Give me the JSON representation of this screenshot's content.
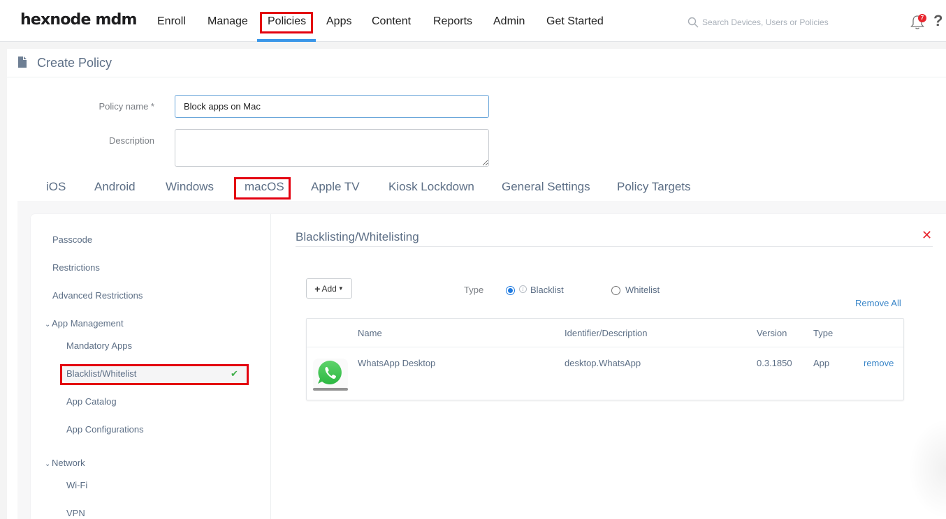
{
  "brand": {
    "logo": "hexnode mdm"
  },
  "topnav": {
    "items": [
      {
        "label": "Enroll"
      },
      {
        "label": "Manage"
      },
      {
        "label": "Policies",
        "active": true
      },
      {
        "label": "Apps"
      },
      {
        "label": "Content"
      },
      {
        "label": "Reports"
      },
      {
        "label": "Admin"
      },
      {
        "label": "Get Started"
      }
    ],
    "search_placeholder": "Search Devices, Users or Policies",
    "notification_count": "7",
    "help_label": "?"
  },
  "page": {
    "title": "Create Policy",
    "form": {
      "policy_name_label": "Policy name *",
      "policy_name_value": "Block apps on Mac",
      "description_label": "Description",
      "description_value": ""
    },
    "os_tabs": [
      {
        "label": "iOS"
      },
      {
        "label": "Android"
      },
      {
        "label": "Windows"
      },
      {
        "label": "macOS",
        "active": true
      },
      {
        "label": "Apple TV"
      },
      {
        "label": "Kiosk Lockdown"
      },
      {
        "label": "General Settings"
      },
      {
        "label": "Policy Targets"
      }
    ]
  },
  "sidebar": {
    "items": [
      {
        "label": "Passcode"
      },
      {
        "label": "Restrictions"
      },
      {
        "label": "Advanced Restrictions"
      },
      {
        "label": "App Management",
        "group": true,
        "expanded": true
      },
      {
        "label": "Mandatory Apps"
      },
      {
        "label": "Blacklist/Whitelist",
        "active": true,
        "configured": true
      },
      {
        "label": "App Catalog"
      },
      {
        "label": "App Configurations"
      },
      {
        "label": "Network",
        "group": true,
        "expanded": true
      },
      {
        "label": "Wi-Fi"
      },
      {
        "label": "VPN"
      }
    ]
  },
  "section": {
    "title": "Blacklisting/Whitelisting",
    "add_button": "Add",
    "type_label": "Type",
    "type_options": [
      {
        "label": "Blacklist",
        "selected": true
      },
      {
        "label": "Whitelist",
        "selected": false
      }
    ],
    "remove_all": "Remove All",
    "table": {
      "columns": [
        "Name",
        "Identifier/Description",
        "Version",
        "Type"
      ],
      "rows": [
        {
          "icon": "whatsapp-icon",
          "name": "WhatsApp Desktop",
          "identifier": "desktop.WhatsApp",
          "version": "0.3.1850",
          "type": "App",
          "action": "remove"
        }
      ]
    }
  },
  "colors": {
    "accent": "#3a96e8",
    "highlight": "#e3000f",
    "link": "#3a86c8",
    "success": "#3fae49",
    "danger": "#e8262e",
    "text": "#5d6f86"
  }
}
